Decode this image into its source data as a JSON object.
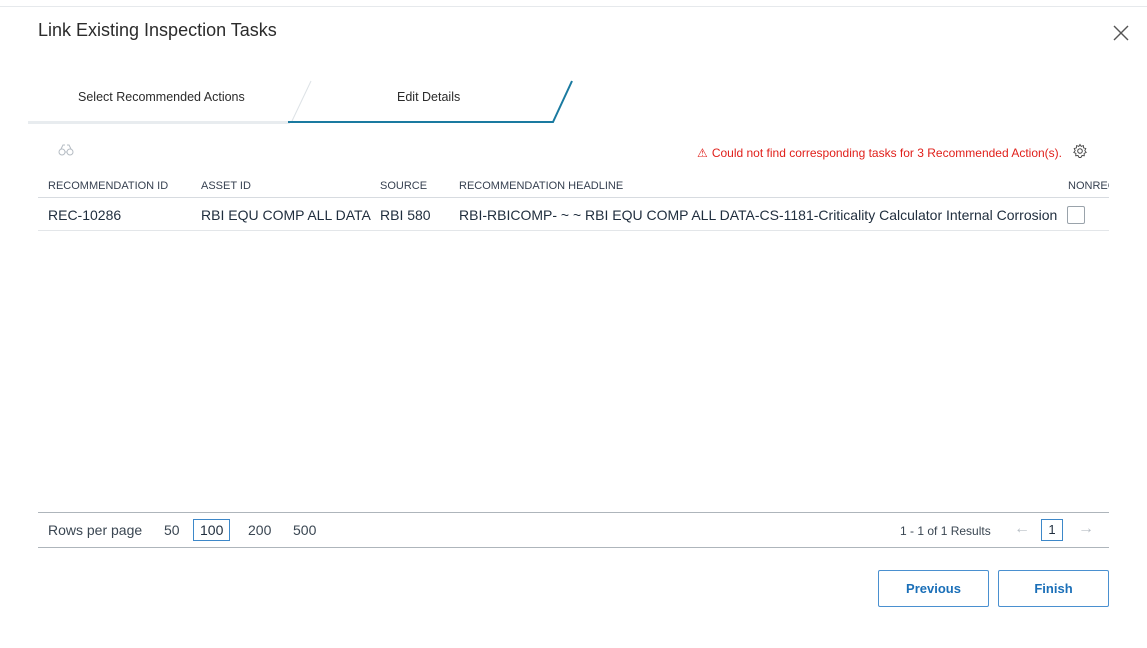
{
  "dialog": {
    "title": "Link Existing Inspection Tasks"
  },
  "steps": [
    {
      "label": "Select Recommended Actions"
    },
    {
      "label": "Edit Details"
    }
  ],
  "toolbar": {
    "warning_icon": "⚠",
    "warning": "Could not find corresponding tasks for 3 Recommended Action(s)."
  },
  "table": {
    "headers": [
      "RECOMMENDATION ID",
      "ASSET ID",
      "SOURCE",
      "RECOMMENDATION HEADLINE",
      "NONREC"
    ],
    "rows": [
      {
        "id": "REC-10286",
        "asset": "RBI EQU COMP ALL DATA",
        "source": "RBI 580",
        "headline": "RBI-RBICOMP- ~ ~ RBI EQU COMP ALL DATA-CS-1181-Criticality Calculator Internal Corrosion",
        "nonrec_checked": false
      }
    ]
  },
  "pager": {
    "rows_label": "Rows per page",
    "options": [
      "50",
      "100",
      "200",
      "500"
    ],
    "selected": "100",
    "results": "1 - 1 of 1 Results",
    "prev_arrow": "←",
    "next_arrow": "→",
    "page": "1"
  },
  "buttons": {
    "previous": "Previous",
    "finish": "Finish"
  },
  "colors": {
    "accent": "#1a7aa0",
    "warning": "#e0201b",
    "button_border": "#4a90d0"
  }
}
